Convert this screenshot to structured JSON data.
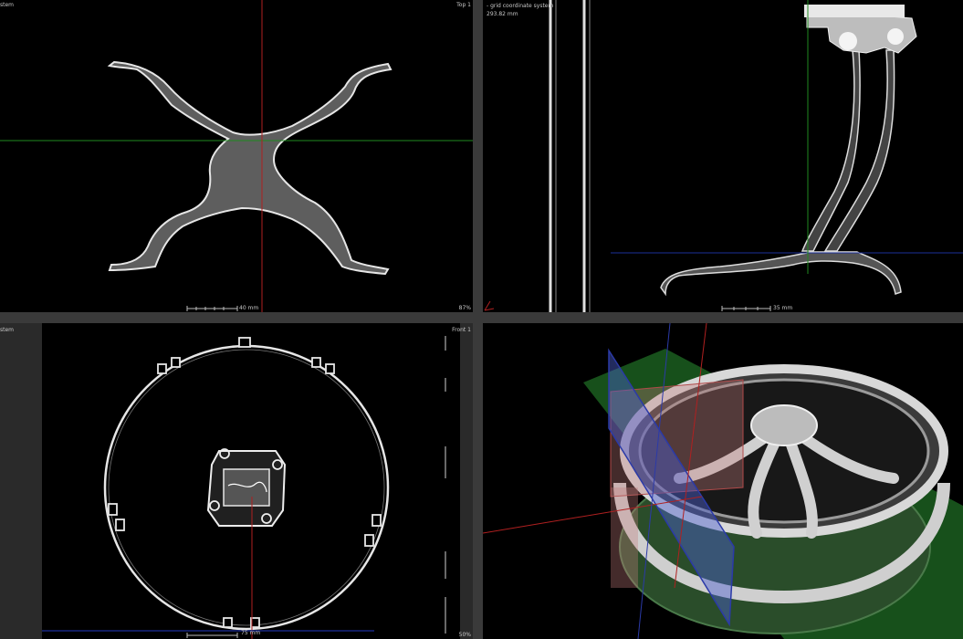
{
  "viewports": {
    "top_left": {
      "corner_left": "stem",
      "view_name": "Top 1",
      "scale_label": "40 mm",
      "zoom": "87%"
    },
    "top_right": {
      "coord_system": "- grid coordinate system",
      "distance": "293.82 mm",
      "scale_label": "35 mm"
    },
    "bottom_left": {
      "corner_left": "stem",
      "view_name": "Front 1",
      "scale_label": "75 mm",
      "zoom": "50%"
    },
    "bottom_right": {}
  },
  "colors": {
    "background": "#000000",
    "frame": "#3a3a3a",
    "crosshair_red": "#b02020",
    "crosshair_green": "#1f8a1f",
    "crosshair_blue": "#1c2f9a",
    "part": "#d8d8d8"
  }
}
